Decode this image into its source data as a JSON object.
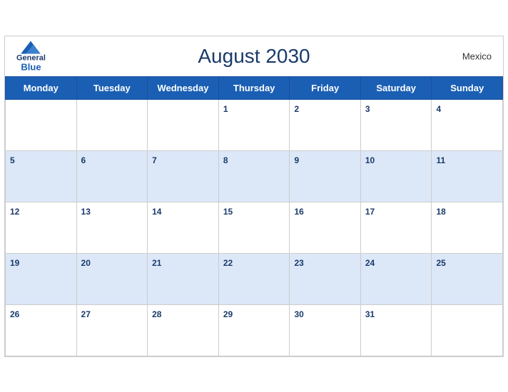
{
  "header": {
    "title": "August 2030",
    "country": "Mexico",
    "logo": {
      "general": "General",
      "blue": "Blue"
    }
  },
  "weekdays": [
    "Monday",
    "Tuesday",
    "Wednesday",
    "Thursday",
    "Friday",
    "Saturday",
    "Sunday"
  ],
  "weeks": [
    [
      null,
      null,
      null,
      1,
      2,
      3,
      4
    ],
    [
      5,
      6,
      7,
      8,
      9,
      10,
      11
    ],
    [
      12,
      13,
      14,
      15,
      16,
      17,
      18
    ],
    [
      19,
      20,
      21,
      22,
      23,
      24,
      25
    ],
    [
      26,
      27,
      28,
      29,
      30,
      31,
      null
    ]
  ]
}
